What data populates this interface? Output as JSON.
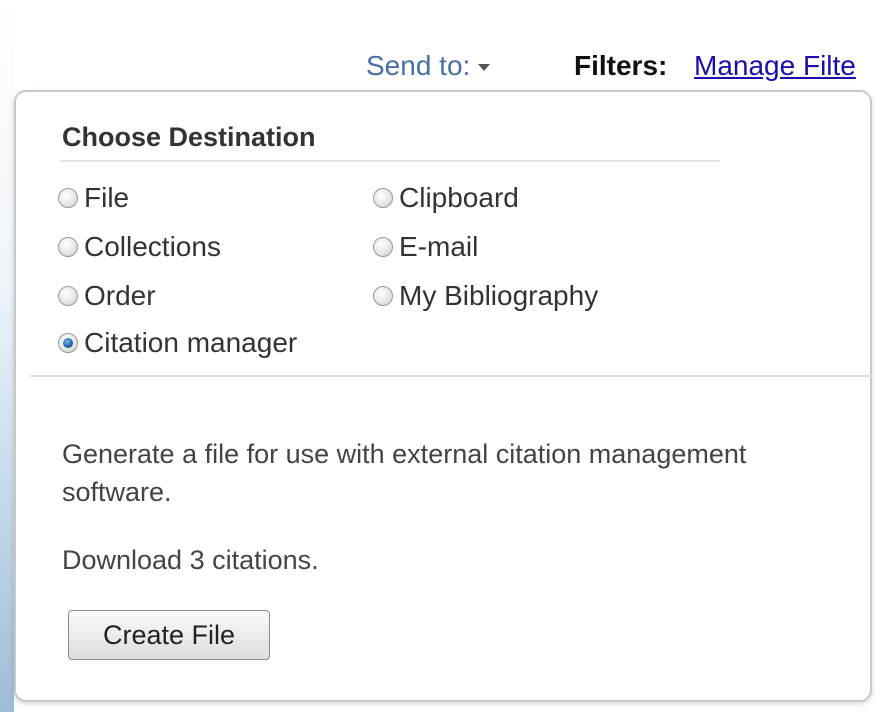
{
  "top_clip_text": "",
  "toolbar": {
    "send_to_label": "Send to:",
    "filters_label": "Filters:",
    "manage_filters_link": "Manage Filte"
  },
  "popup": {
    "title": "Choose Destination",
    "options": [
      {
        "label": "File",
        "checked": false
      },
      {
        "label": "Clipboard",
        "checked": false
      },
      {
        "label": "Collections",
        "checked": false
      },
      {
        "label": "E-mail",
        "checked": false
      },
      {
        "label": "Order",
        "checked": false
      },
      {
        "label": "My Bibliography",
        "checked": false
      },
      {
        "label": "Citation manager",
        "checked": true
      }
    ],
    "description": "Generate a file for use with external citation management software.",
    "download_text": "Download 3 citations.",
    "create_button_label": "Create File"
  },
  "colors": {
    "link": "#1a0dab",
    "send_to": "#4a6fa5",
    "radio_selected": "#1f5fa8"
  }
}
